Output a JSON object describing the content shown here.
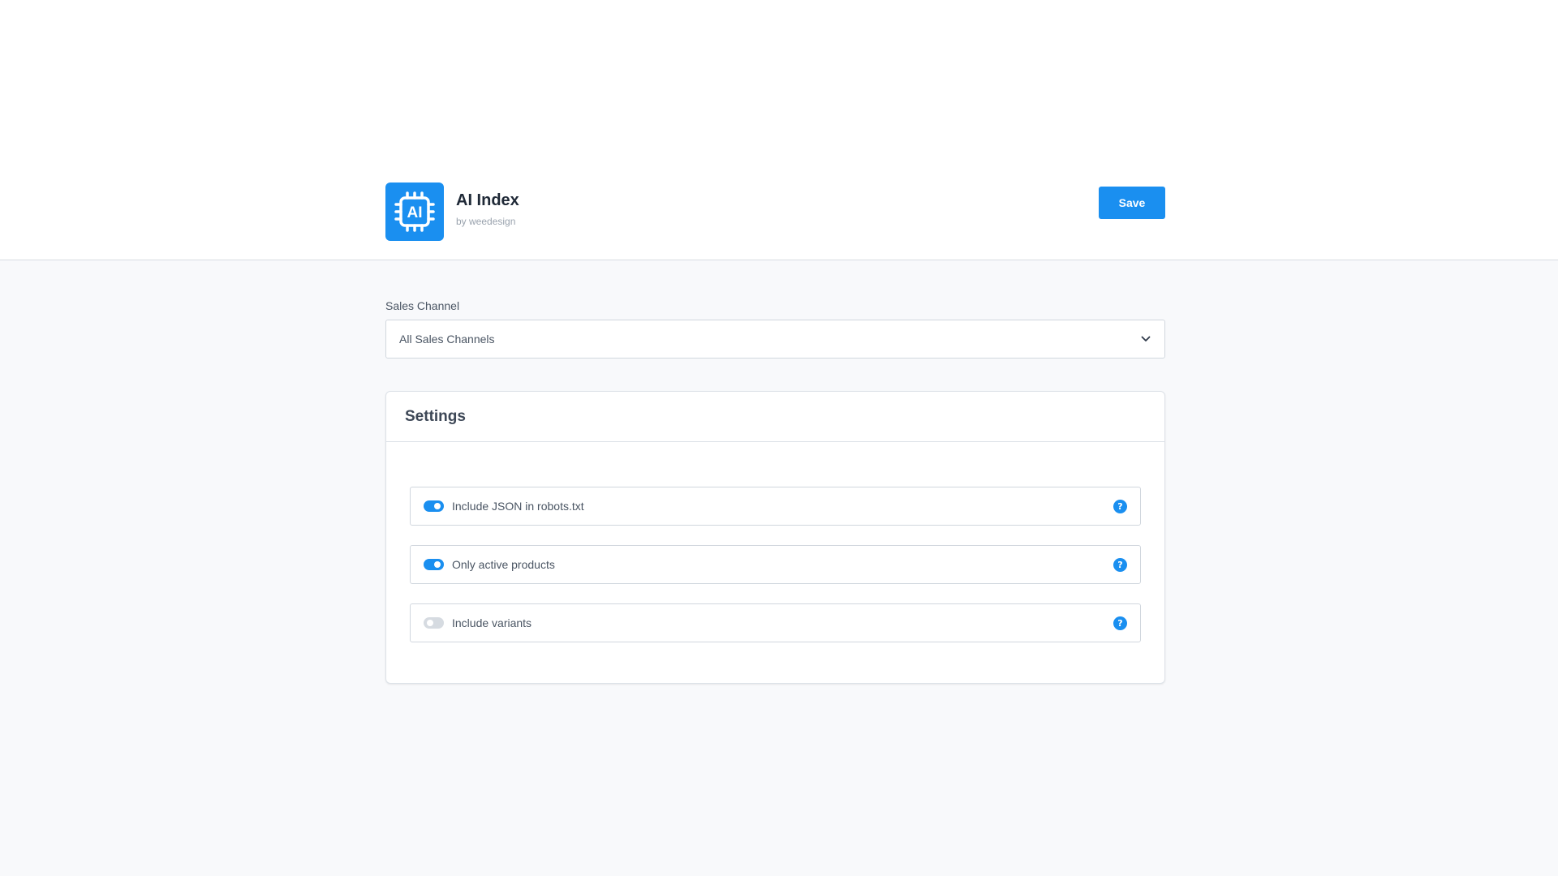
{
  "app": {
    "title": "AI Index",
    "vendor": "by weedesign",
    "logo_text": "AI",
    "logo_icon": "ai-chip-icon"
  },
  "toolbar": {
    "save_label": "Save"
  },
  "sales_channel": {
    "label": "Sales Channel",
    "selected": "All Sales Channels"
  },
  "settings": {
    "title": "Settings",
    "options": [
      {
        "label": "Include JSON in robots.txt",
        "enabled": true
      },
      {
        "label": "Only active products",
        "enabled": true
      },
      {
        "label": "Include variants",
        "enabled": false
      }
    ],
    "help_glyph": "?"
  },
  "colors": {
    "accent": "#1a8ff0",
    "toggle_off": "#d6dbe1",
    "background": "#f8f9fb"
  }
}
